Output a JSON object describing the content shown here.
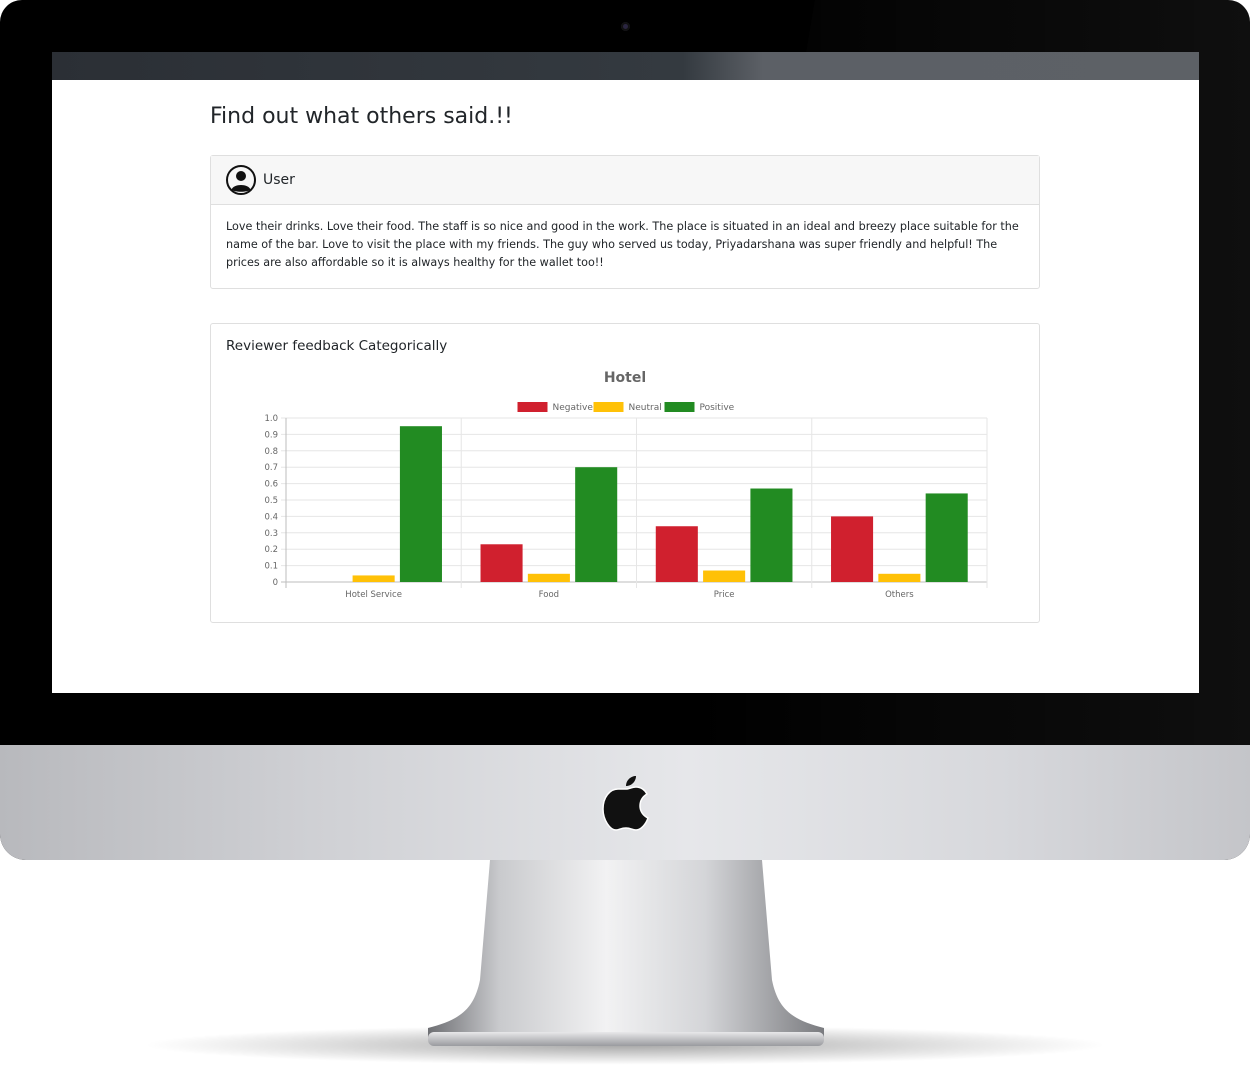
{
  "page": {
    "title": "Find out what others said.!!"
  },
  "review": {
    "user_name": "User",
    "text": "Love their drinks. Love their food. The staff is so nice and good in the work. The place is situated in an ideal and breezy place suitable for the name of the bar. Love to visit the place with my friends. The guy who served us today, Priyadarshana was super friendly and helpful! The prices are also affordable so it is always healthy for the wallet too!!"
  },
  "chart_section": {
    "heading": "Reviewer feedback Categorically"
  },
  "icons": {
    "user": "user-circle-icon",
    "brand": "apple-logo"
  },
  "chart_data": {
    "type": "bar",
    "title": "Hotel",
    "categories": [
      "Hotel Service",
      "Food",
      "Price",
      "Others"
    ],
    "series": [
      {
        "name": "Negative",
        "color": "#d0202e",
        "values": [
          0.0,
          0.23,
          0.34,
          0.4
        ]
      },
      {
        "name": "Neutral",
        "color": "#ffc107",
        "values": [
          0.04,
          0.05,
          0.07,
          0.05
        ]
      },
      {
        "name": "Positive",
        "color": "#228b22",
        "values": [
          0.95,
          0.7,
          0.57,
          0.54
        ]
      }
    ],
    "ylim": [
      0,
      1.0
    ],
    "yticks": [
      "0",
      "0.1",
      "0.2",
      "0.3",
      "0.4",
      "0.5",
      "0.6",
      "0.7",
      "0.8",
      "0.9",
      "1.0"
    ],
    "grid": true,
    "legend_position": "top"
  }
}
